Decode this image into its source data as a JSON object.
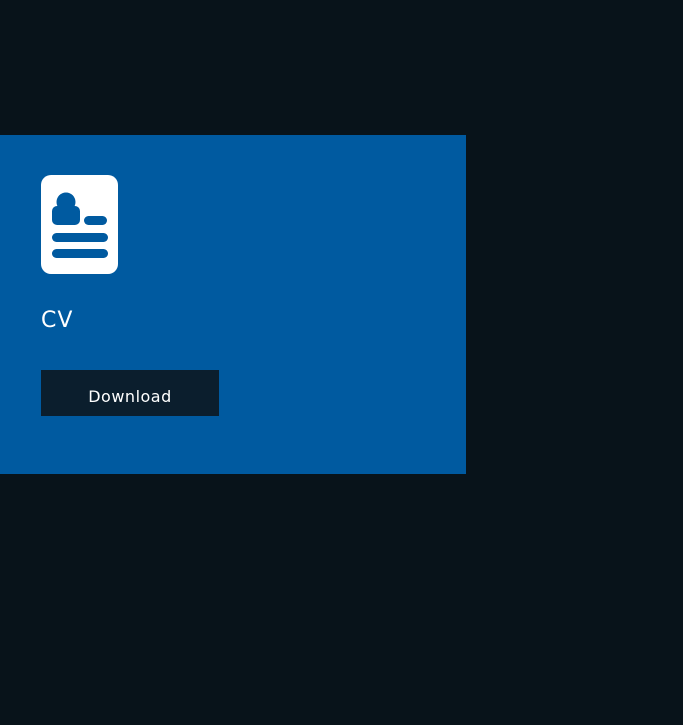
{
  "card": {
    "icon": "cv-document-icon",
    "title": "CV",
    "button_label": "Download"
  },
  "colors": {
    "background": "#08131a",
    "card": "#005aa0",
    "button": "#0b1e2d",
    "text": "#ffffff"
  }
}
